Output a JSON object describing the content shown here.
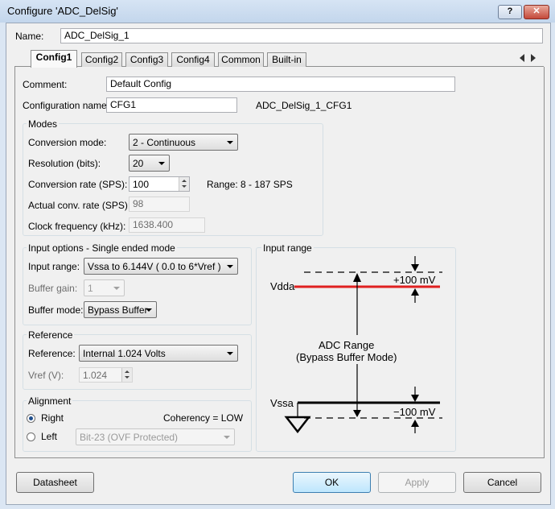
{
  "window": {
    "title": "Configure 'ADC_DelSig'",
    "help_label": "?",
    "close_label": "✕"
  },
  "name": {
    "label": "Name:",
    "value": "ADC_DelSig_1"
  },
  "tabs": [
    {
      "label": "Config1"
    },
    {
      "label": "Config2"
    },
    {
      "label": "Config3"
    },
    {
      "label": "Config4"
    },
    {
      "label": "Common"
    },
    {
      "label": "Built-in"
    }
  ],
  "tab_nav": {
    "left_icon": "triangle-left-icon",
    "right_icon": "triangle-right-icon"
  },
  "config": {
    "comment_label": "Comment:",
    "comment_value": "Default Config",
    "config_name_label": "Configuration name:",
    "config_name_value": "CFG1",
    "full_name": "ADC_DelSig_1_CFG1"
  },
  "modes": {
    "title": "Modes",
    "conversion_mode_label": "Conversion mode:",
    "conversion_mode_value": "2 - Continuous",
    "resolution_label": "Resolution (bits):",
    "resolution_value": "20",
    "conv_rate_label": "Conversion rate (SPS):",
    "conv_rate_value": "100",
    "range_text": "Range: 8 - 187 SPS",
    "actual_rate_label": "Actual conv. rate (SPS):",
    "actual_rate_value": "98",
    "clock_label": "Clock frequency (kHz):",
    "clock_value": "1638.400"
  },
  "input_options": {
    "title": "Input options - Single ended mode",
    "input_range_label": "Input range:",
    "input_range_value": "Vssa to 6.144V ( 0.0 to 6*Vref )",
    "buffer_gain_label": "Buffer gain:",
    "buffer_gain_value": "1",
    "buffer_mode_label": "Buffer mode:",
    "buffer_mode_value": "Bypass Buffer"
  },
  "reference": {
    "title": "Reference",
    "reference_label": "Reference:",
    "reference_value": "Internal 1.024 Volts",
    "vref_label": "Vref (V):",
    "vref_value": "1.024"
  },
  "alignment": {
    "title": "Alignment",
    "right_label": "Right",
    "left_label": "Left",
    "coherency_text": "Coherency = LOW",
    "left_option_value": "Bit-23 (OVF Protected)"
  },
  "input_range_diagram": {
    "title": "Input range",
    "vdda": "Vdda",
    "vssa": "Vssa",
    "top_margin": "+100 mV",
    "bottom_margin": "−100 mV",
    "range_line1": "ADC Range",
    "range_line2": "(Bypass Buffer Mode)",
    "vdda_color": "#e02020"
  },
  "buttons": {
    "datasheet": "Datasheet",
    "ok": "OK",
    "apply": "Apply",
    "cancel": "Cancel"
  }
}
